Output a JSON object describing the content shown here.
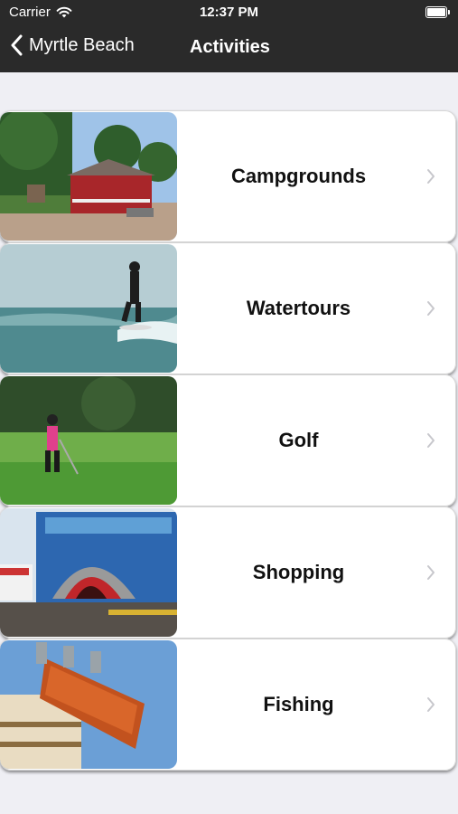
{
  "status": {
    "carrier": "Carrier",
    "time": "12:37 PM"
  },
  "nav": {
    "back_label": "Myrtle Beach",
    "title": "Activities"
  },
  "activities": [
    {
      "label": "Campgrounds",
      "image": "campground-photo"
    },
    {
      "label": "Watertours",
      "image": "surfer-photo"
    },
    {
      "label": "Golf",
      "image": "golfer-photo"
    },
    {
      "label": "Shopping",
      "image": "shark-store-photo"
    },
    {
      "label": "Fishing",
      "image": "pier-sign-photo"
    }
  ],
  "colors": {
    "bar": "#2a2a2a",
    "background": "#efeff4",
    "chevron": "#c7c7cc"
  }
}
